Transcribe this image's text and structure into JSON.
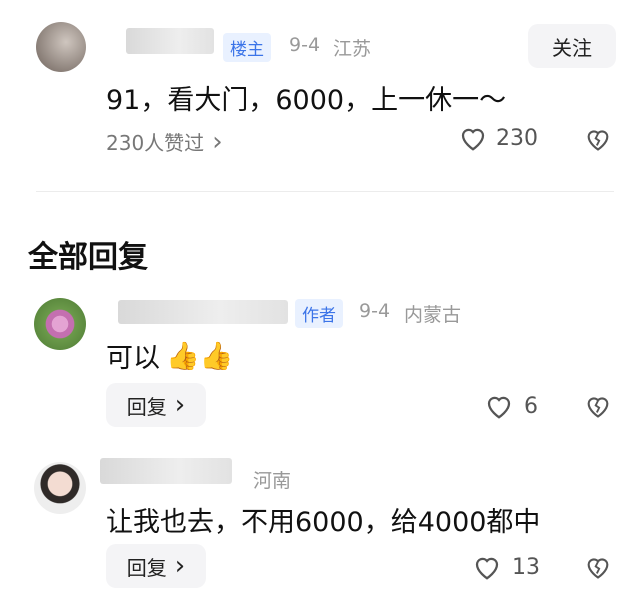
{
  "post": {
    "badge": "楼主",
    "date": "9-4",
    "location": "江苏",
    "follow_label": "关注",
    "text": "91，看大门，6000，上一休一～",
    "liked_by": "230人赞过",
    "chevron": "›",
    "like_count": "230",
    "like_icon": "heart-outline",
    "dislike_icon": "broken-heart"
  },
  "section_title": "全部回复",
  "comments": [
    {
      "badge": "作者",
      "date": "9-4",
      "location": "内蒙古",
      "text": "可以",
      "emoji": "👍👍",
      "reply_label": "回复",
      "reply_chevron": "›",
      "like_count": "6"
    },
    {
      "location": "河南",
      "text": "让我也去，不用6000，给4000都中",
      "reply_label": "回复",
      "reply_chevron": "›",
      "like_count": "13"
    }
  ],
  "colors": {
    "badge_text": "#3b74e8",
    "badge_bg": "#e9f1ff",
    "meta": "#999999"
  }
}
